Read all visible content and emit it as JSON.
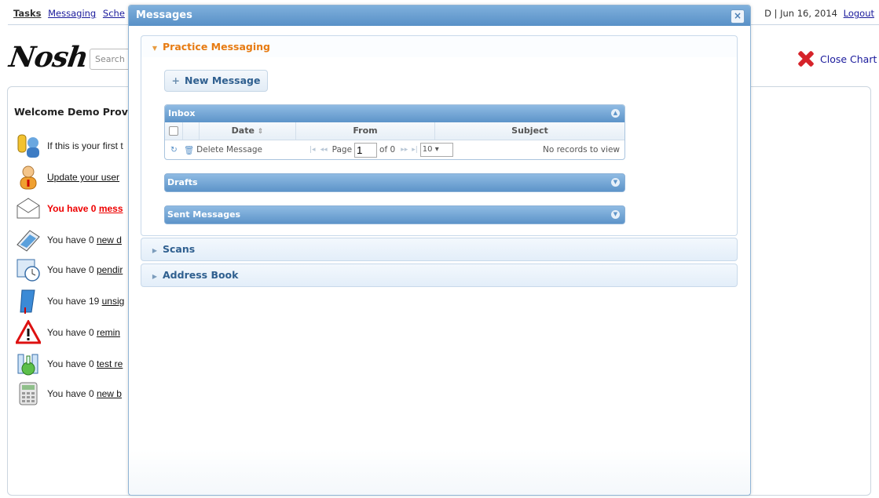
{
  "nav": {
    "links": [
      "Tasks",
      "Messaging",
      "Sche"
    ],
    "right_prefix": "D | Jun 16, 2014",
    "logout": "Logout"
  },
  "logo": "Nosh",
  "search": {
    "placeholder": "Search"
  },
  "close_chart": "Close Chart",
  "welcome": {
    "title": "Welcome Demo Provic",
    "items": [
      {
        "prefix": "If this is your first t",
        "link": ""
      },
      {
        "prefix": "",
        "link": "Update your user"
      },
      {
        "prefix": "You have 0 ",
        "link": "mess"
      },
      {
        "prefix": "You have 0 ",
        "link": "new d"
      },
      {
        "prefix": "You have 0 ",
        "link": "pendir"
      },
      {
        "prefix": "You have 19 ",
        "link": "unsig"
      },
      {
        "prefix": "You have 0 ",
        "link": "remin"
      },
      {
        "prefix": "You have 0 ",
        "link": "test re"
      },
      {
        "prefix": "You have 0 ",
        "link": "new b"
      }
    ]
  },
  "modal": {
    "title": "Messages",
    "close_symbol": "×",
    "sections": [
      {
        "label": "Practice Messaging",
        "expanded": true
      },
      {
        "label": "Scans",
        "expanded": false
      },
      {
        "label": "Address Book",
        "expanded": false
      }
    ],
    "new_message": "New Message",
    "inbox": {
      "caption": "Inbox",
      "columns": [
        "Date",
        "From",
        "Subject"
      ],
      "delete_label": "Delete Message",
      "page_label": "Page",
      "page_value": "1",
      "of_label": "of 0",
      "rows_per_page": "10",
      "records_text": "No records to view"
    },
    "drafts": "Drafts",
    "sent": "Sent Messages"
  },
  "colors": {
    "accent": "#5890c7",
    "active_section": "#e77b12",
    "alert": "#e00000"
  }
}
